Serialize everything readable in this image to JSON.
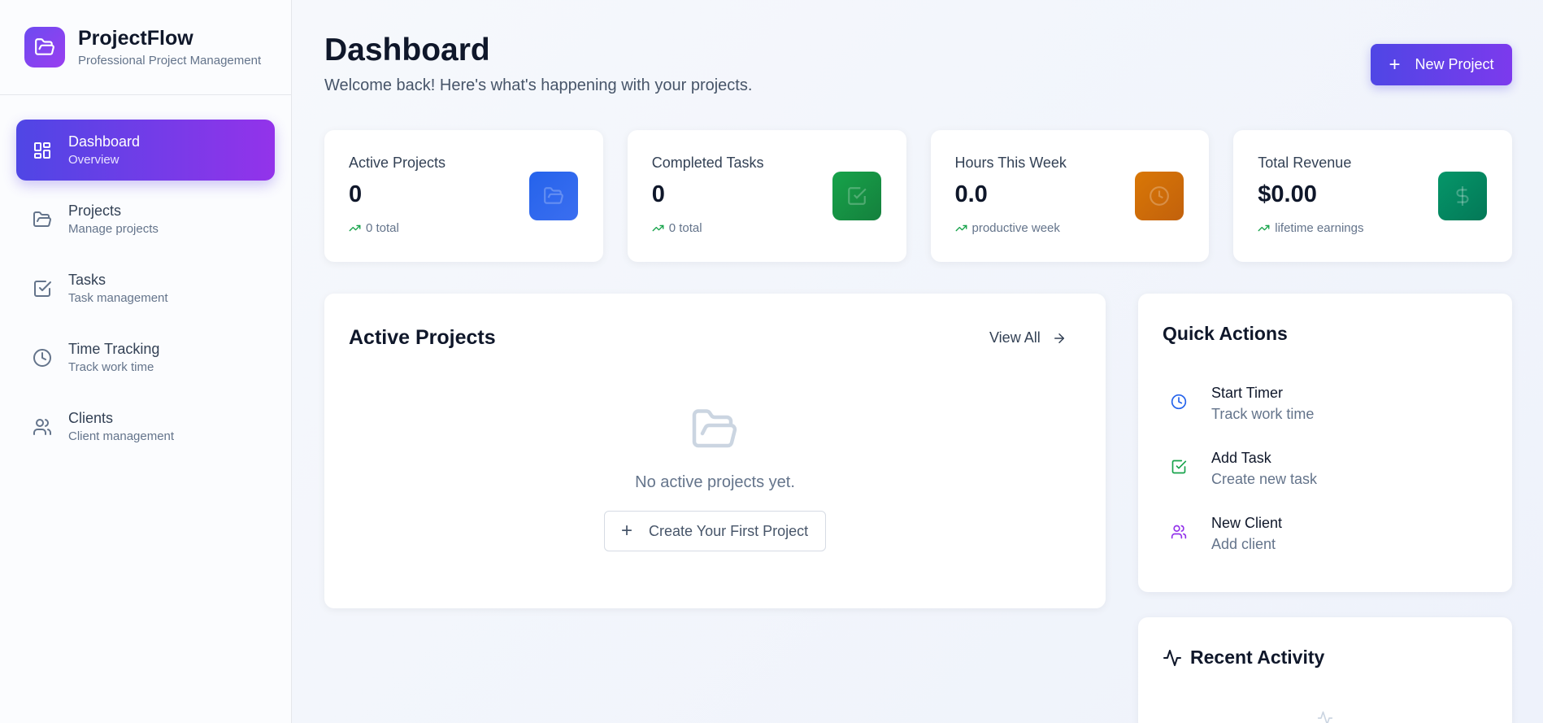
{
  "brand": {
    "name": "ProjectFlow",
    "subtitle": "Professional Project Management"
  },
  "sidebar": {
    "items": [
      {
        "label": "Dashboard",
        "sub": "Overview",
        "icon": "dashboard-grid-icon",
        "active": true
      },
      {
        "label": "Projects",
        "sub": "Manage projects",
        "icon": "folder-icon"
      },
      {
        "label": "Tasks",
        "sub": "Task management",
        "icon": "checkbox-icon"
      },
      {
        "label": "Time Tracking",
        "sub": "Track work time",
        "icon": "clock-icon"
      },
      {
        "label": "Clients",
        "sub": "Client management",
        "icon": "users-icon"
      }
    ]
  },
  "header": {
    "title": "Dashboard",
    "subtitle": "Welcome back! Here's what's happening with your projects.",
    "new_project_label": "New Project"
  },
  "stats": [
    {
      "label": "Active Projects",
      "value": "0",
      "trend": "0 total",
      "icon": "folder-icon",
      "color": "#2563eb"
    },
    {
      "label": "Completed Tasks",
      "value": "0",
      "trend": "0 total",
      "icon": "checkbox-icon",
      "color": "#16a34a"
    },
    {
      "label": "Hours This Week",
      "value": "0.0",
      "trend": "productive week",
      "icon": "clock-icon",
      "color": "#d97706"
    },
    {
      "label": "Total Revenue",
      "value": "$0.00",
      "trend": "lifetime earnings",
      "icon": "dollar-icon",
      "color": "#059669"
    }
  ],
  "projects_panel": {
    "title": "Active Projects",
    "view_all": "View All",
    "empty_text": "No active projects yet.",
    "create_label": "Create Your First Project"
  },
  "quick_actions": {
    "title": "Quick Actions",
    "items": [
      {
        "label": "Start Timer",
        "sub": "Track work time",
        "icon": "clock-icon",
        "color": "#2563eb"
      },
      {
        "label": "Add Task",
        "sub": "Create new task",
        "icon": "checkbox-icon",
        "color": "#16a34a"
      },
      {
        "label": "New Client",
        "sub": "Add client",
        "icon": "users-icon",
        "color": "#9333ea"
      }
    ]
  },
  "activity": {
    "title": "Recent Activity"
  }
}
